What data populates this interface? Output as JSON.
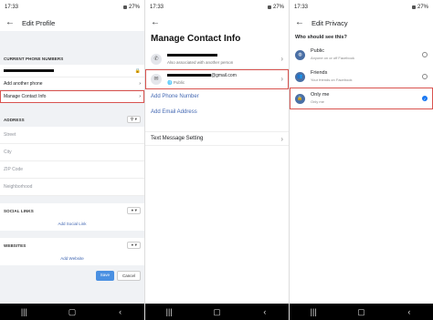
{
  "status": {
    "time": "17:33",
    "battery": "27%"
  },
  "p1": {
    "title": "Edit Profile",
    "current_phone": "CURRENT PHONE NUMBERS",
    "add_phone": "Add another phone",
    "manage": "Manage Contact Info",
    "address": "ADDRESS",
    "street": "Street",
    "city": "City",
    "zip": "ZIP Code",
    "neighborhood": "Neighborhood",
    "social": "SOCIAL LINKS",
    "add_social": "Add Social Link",
    "websites": "WEBSITES",
    "add_website": "Add Website",
    "save": "Save",
    "cancel": "Cancel"
  },
  "p2": {
    "title": "Manage Contact Info",
    "phone_sub": "Also associated with another person",
    "email_domain": "@gmail.com",
    "email_sub": "Public",
    "add_phone": "Add Phone Number",
    "add_email": "Add Email Address",
    "text_setting": "Text Message Setting"
  },
  "p3": {
    "title": "Edit Privacy",
    "question": "Who should see this?",
    "options": [
      {
        "label": "Public",
        "sub": "Anyone on or off Facebook"
      },
      {
        "label": "Friends",
        "sub": "Your friends on Facebook"
      },
      {
        "label": "Only me",
        "sub": "Only me"
      }
    ]
  },
  "colors": {
    "accent": "#1877f2",
    "highlight": "#d9534f"
  }
}
